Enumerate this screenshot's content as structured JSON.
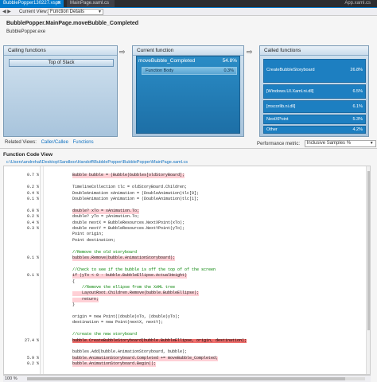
{
  "tabs": {
    "active": "BubblePopper130227.vsps",
    "inactive": "MainPage.xaml.cs",
    "right": "App.xaml.cs"
  },
  "viewbar": {
    "label": "Current View:",
    "selected": "Function Details"
  },
  "header": {
    "title": "BubblePopper.MainPage.moveBubble_Completed",
    "subtitle": "BubblePopper.exe"
  },
  "calling": {
    "title": "Calling functions",
    "top_label": "Top of Stack"
  },
  "current": {
    "title": "Current function",
    "func_name": "moveBubble_Completed",
    "func_pct": "54.8%",
    "body_label": "Function Body",
    "body_pct": "0.3%"
  },
  "called": {
    "title": "Called functions",
    "items": [
      {
        "label": "CreateBubbleStoryboard",
        "pct": "26.8%"
      },
      {
        "label": "[Windows.UI.Xaml.ni.dll]",
        "pct": "6.5%"
      },
      {
        "label": "[mscorlib.ni.dll]",
        "pct": "6.1%"
      },
      {
        "label": "NextXPoint",
        "pct": "5.3%"
      },
      {
        "label": "Other",
        "pct": "4.2%"
      },
      {
        "label": "",
        "pct": ""
      }
    ]
  },
  "related": {
    "label": "Related Views:",
    "link1": "Caller/Callee",
    "link2": "Functions"
  },
  "metric": {
    "label": "Performance metric:",
    "value": "Inclusive Samples %"
  },
  "codeview": {
    "title": "Function Code View",
    "path": "c:\\Users\\andrehal\\Desktop\\Sandbox\\Handoff\\BubblePopper\\BubblePopper\\MainPage.xaml.cs",
    "lines": [
      {
        "pct": "",
        "code": "",
        "hl": ""
      },
      {
        "pct": "0.7 %",
        "code": "Bubble bubble = (Bubble)bubbles[oldStoryBoard];",
        "hl": "pink"
      },
      {
        "pct": "",
        "code": "",
        "hl": ""
      },
      {
        "pct": "0.2 %",
        "code": "TimelineCollection tlc = oldStoryBoard.Children;",
        "hl": ""
      },
      {
        "pct": "0.4 %",
        "code": "DoubleAnimation xAnimation = (DoubleAnimation)tlc[0];",
        "hl": ""
      },
      {
        "pct": "0.1 %",
        "code": "DoubleAnimation yAnimation = (DoubleAnimation)tlc[1];",
        "hl": ""
      },
      {
        "pct": "",
        "code": "",
        "hl": ""
      },
      {
        "pct": "6.0 %",
        "code": "double? xTo = xAnimation.To;",
        "hl": "pink"
      },
      {
        "pct": "0.2 %",
        "code": "double? yTo = yAnimation.To;",
        "hl": ""
      },
      {
        "pct": "0.4 %",
        "code": "double nextX = BubbleResources.NextXPoint(xTo);",
        "hl": ""
      },
      {
        "pct": "0.3 %",
        "code": "double nextY = BubbleResources.NextYPoint(yTo);",
        "hl": ""
      },
      {
        "pct": "",
        "code": "Point origin;",
        "hl": ""
      },
      {
        "pct": "",
        "code": "Point destination;",
        "hl": ""
      },
      {
        "pct": "",
        "code": "",
        "hl": ""
      },
      {
        "pct": "",
        "code": "//Remove the old storyboard",
        "hl": "",
        "cm": true
      },
      {
        "pct": "0.1 %",
        "code": "bubbles.Remove(bubble.AnimationStoryboard);",
        "hl": "pink"
      },
      {
        "pct": "",
        "code": "",
        "hl": ""
      },
      {
        "pct": "",
        "code": "//Check to see if the bubble is off the top of of the screen",
        "hl": "",
        "cm": true
      },
      {
        "pct": "0.1 %",
        "code": "if (yTo < 0 - bubble.BubbleEllipse.ActualHeight)",
        "hl": "pink"
      },
      {
        "pct": "",
        "code": "{",
        "hl": ""
      },
      {
        "pct": "",
        "code": "    //Remove the ellipse from the XAML tree",
        "hl": "",
        "cm": true
      },
      {
        "pct": "",
        "code": "    LayoutRoot.Children.Remove(bubble.BubbleEllipse);",
        "hl": "pink"
      },
      {
        "pct": "",
        "code": "    return;",
        "hl": "pink"
      },
      {
        "pct": "",
        "code": "}",
        "hl": ""
      },
      {
        "pct": "",
        "code": "",
        "hl": ""
      },
      {
        "pct": "",
        "code": "origin = new Point((double)xTo, (double)yTo);",
        "hl": ""
      },
      {
        "pct": "",
        "code": "destination = new Point(nextX, nextY);",
        "hl": ""
      },
      {
        "pct": "",
        "code": "",
        "hl": ""
      },
      {
        "pct": "",
        "code": "//create the new storyboard",
        "hl": "",
        "cm": true
      },
      {
        "pct": "27.4 %",
        "code": "bubble.CreateBubbleStoryboard(bubble.BubbleEllipse, origin, destination);",
        "hl": "red"
      },
      {
        "pct": "",
        "code": "",
        "hl": ""
      },
      {
        "pct": "",
        "code": "bubbles.Add(bubble.AnimationStoryboard, bubble);",
        "hl": ""
      },
      {
        "pct": "5.9 %",
        "code": "bubble.AnimationStoryboard.Completed += moveBubble_Completed;",
        "hl": "pink"
      },
      {
        "pct": "0.2 %",
        "code": "bubble.AnimationStoryboard.Begin();",
        "hl": "pink"
      },
      {
        "pct": "",
        "code": "",
        "hl": ""
      }
    ]
  },
  "footer": {
    "zoom": "100 %"
  },
  "colors": {
    "accent": "#007acc",
    "current_fn": "#1d6fa6",
    "hot_line": "#f0706e",
    "warm_line": "#ffd0d6"
  }
}
